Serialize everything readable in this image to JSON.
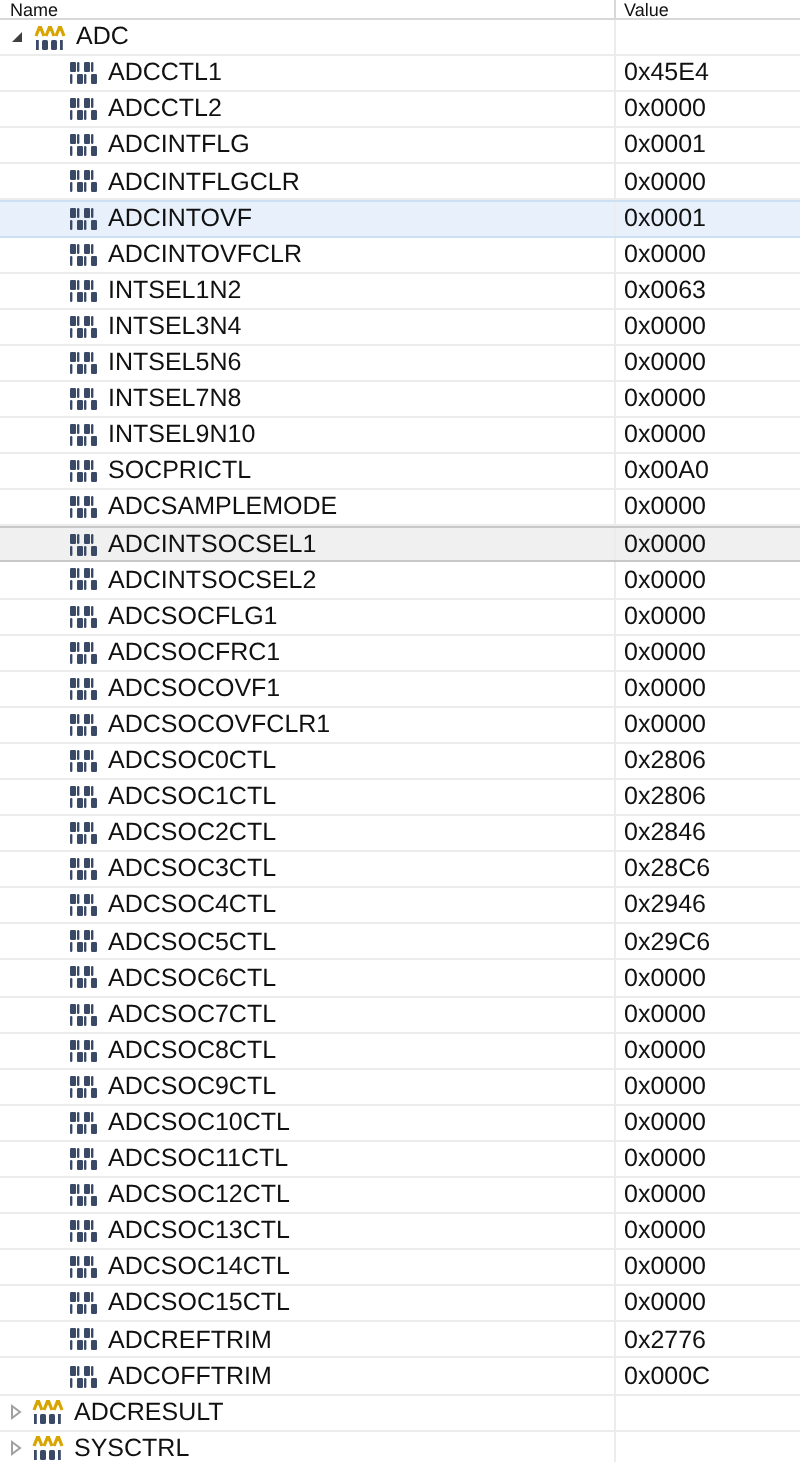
{
  "columns": [
    "Name",
    "Value"
  ],
  "groups": [
    {
      "name": "ADC",
      "expanded": true,
      "registers": [
        {
          "name": "ADCCTL1",
          "value": "0x45E4",
          "selected": false,
          "focused": false
        },
        {
          "name": "ADCCTL2",
          "value": "0x0000",
          "selected": false,
          "focused": false
        },
        {
          "name": "ADCINTFLG",
          "value": "0x0001",
          "selected": false,
          "focused": false
        },
        {
          "name": "ADCINTFLGCLR",
          "value": "0x0000",
          "selected": false,
          "focused": false
        },
        {
          "name": "ADCINTOVF",
          "value": "0x0001",
          "selected": true,
          "focused": false
        },
        {
          "name": "ADCINTOVFCLR",
          "value": "0x0000",
          "selected": false,
          "focused": false
        },
        {
          "name": "INTSEL1N2",
          "value": "0x0063",
          "selected": false,
          "focused": false
        },
        {
          "name": "INTSEL3N4",
          "value": "0x0000",
          "selected": false,
          "focused": false
        },
        {
          "name": "INTSEL5N6",
          "value": "0x0000",
          "selected": false,
          "focused": false
        },
        {
          "name": "INTSEL7N8",
          "value": "0x0000",
          "selected": false,
          "focused": false
        },
        {
          "name": "INTSEL9N10",
          "value": "0x0000",
          "selected": false,
          "focused": false
        },
        {
          "name": "SOCPRICTL",
          "value": "0x00A0",
          "selected": false,
          "focused": false
        },
        {
          "name": "ADCSAMPLEMODE",
          "value": "0x0000",
          "selected": false,
          "focused": false
        },
        {
          "name": "ADCINTSOCSEL1",
          "value": "0x0000",
          "selected": false,
          "focused": true
        },
        {
          "name": "ADCINTSOCSEL2",
          "value": "0x0000",
          "selected": false,
          "focused": false
        },
        {
          "name": "ADCSOCFLG1",
          "value": "0x0000",
          "selected": false,
          "focused": false
        },
        {
          "name": "ADCSOCFRC1",
          "value": "0x0000",
          "selected": false,
          "focused": false
        },
        {
          "name": "ADCSOCOVF1",
          "value": "0x0000",
          "selected": false,
          "focused": false
        },
        {
          "name": "ADCSOCOVFCLR1",
          "value": "0x0000",
          "selected": false,
          "focused": false
        },
        {
          "name": "ADCSOC0CTL",
          "value": "0x2806",
          "selected": false,
          "focused": false
        },
        {
          "name": "ADCSOC1CTL",
          "value": "0x2806",
          "selected": false,
          "focused": false
        },
        {
          "name": "ADCSOC2CTL",
          "value": "0x2846",
          "selected": false,
          "focused": false
        },
        {
          "name": "ADCSOC3CTL",
          "value": "0x28C6",
          "selected": false,
          "focused": false
        },
        {
          "name": "ADCSOC4CTL",
          "value": "0x2946",
          "selected": false,
          "focused": false
        },
        {
          "name": "ADCSOC5CTL",
          "value": "0x29C6",
          "selected": false,
          "focused": false
        },
        {
          "name": "ADCSOC6CTL",
          "value": "0x0000",
          "selected": false,
          "focused": false
        },
        {
          "name": "ADCSOC7CTL",
          "value": "0x0000",
          "selected": false,
          "focused": false
        },
        {
          "name": "ADCSOC8CTL",
          "value": "0x0000",
          "selected": false,
          "focused": false
        },
        {
          "name": "ADCSOC9CTL",
          "value": "0x0000",
          "selected": false,
          "focused": false
        },
        {
          "name": "ADCSOC10CTL",
          "value": "0x0000",
          "selected": false,
          "focused": false
        },
        {
          "name": "ADCSOC11CTL",
          "value": "0x0000",
          "selected": false,
          "focused": false
        },
        {
          "name": "ADCSOC12CTL",
          "value": "0x0000",
          "selected": false,
          "focused": false
        },
        {
          "name": "ADCSOC13CTL",
          "value": "0x0000",
          "selected": false,
          "focused": false
        },
        {
          "name": "ADCSOC14CTL",
          "value": "0x0000",
          "selected": false,
          "focused": false
        },
        {
          "name": "ADCSOC15CTL",
          "value": "0x0000",
          "selected": false,
          "focused": false
        },
        {
          "name": "ADCREFTRIM",
          "value": "0x2776",
          "selected": false,
          "focused": false
        },
        {
          "name": "ADCOFFTRIM",
          "value": "0x000C",
          "selected": false,
          "focused": false
        }
      ]
    },
    {
      "name": "ADCRESULT",
      "expanded": false
    },
    {
      "name": "SYSCTRL",
      "expanded": false
    }
  ]
}
